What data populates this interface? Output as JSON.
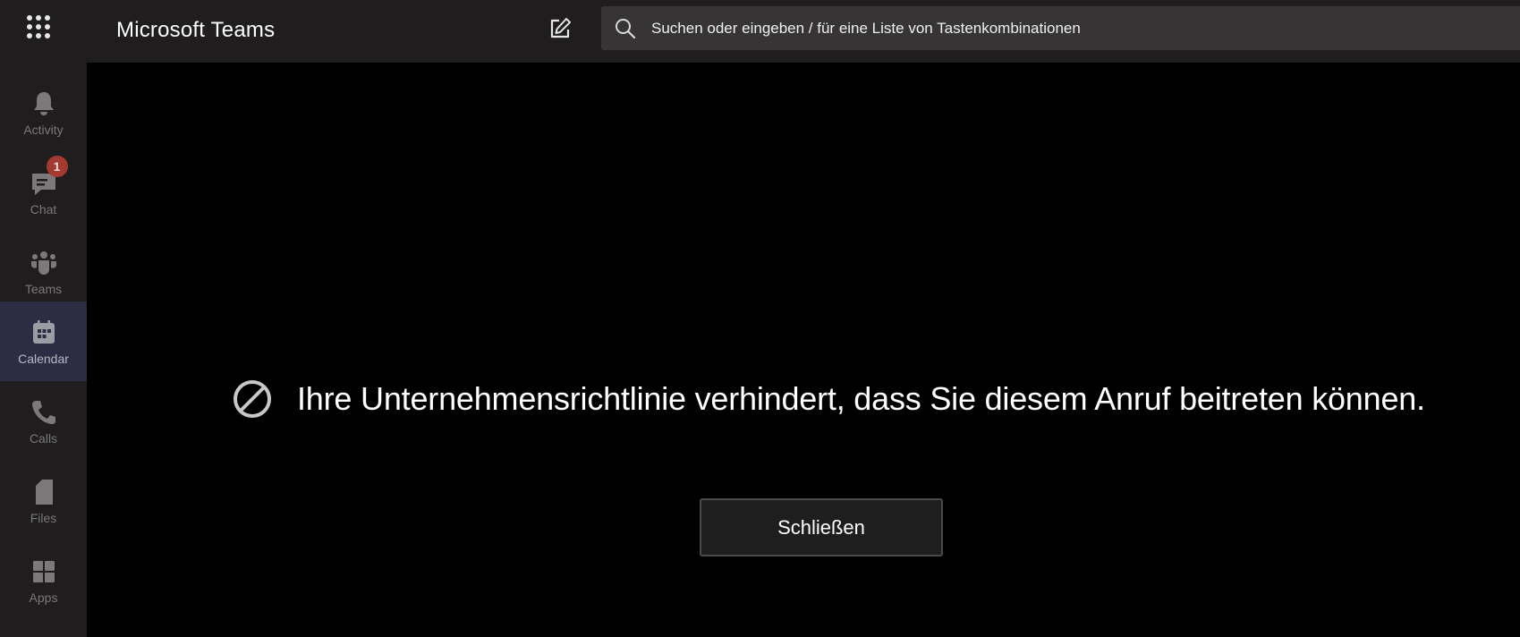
{
  "header": {
    "app_title": "Microsoft Teams",
    "search_placeholder": "Suchen oder eingeben / für eine Liste von Tastenkombinationen",
    "icons": {
      "app_launcher": "waffle-grid-icon",
      "compose": "compose-icon",
      "search": "search-icon"
    }
  },
  "sidebar": {
    "items": [
      {
        "label": "Activity",
        "icon": "bell-icon",
        "active": false
      },
      {
        "label": "Chat",
        "icon": "chat-icon",
        "active": false,
        "badge": "1"
      },
      {
        "label": "Teams",
        "icon": "teams-icon",
        "active": false
      },
      {
        "label": "Calendar",
        "icon": "calendar-icon",
        "active": true
      },
      {
        "label": "Calls",
        "icon": "phone-icon",
        "active": false
      },
      {
        "label": "Files",
        "icon": "file-icon",
        "active": false
      },
      {
        "label": "Apps",
        "icon": "apps-icon",
        "active": false
      }
    ],
    "active_color": "#2c2d45",
    "badge_color": "#a33a30"
  },
  "main": {
    "message": "Ihre Unternehmensrichtlinie verhindert, dass Sie diesem Anruf beitreten können.",
    "message_icon": "block-icon",
    "close_button_label": "Schließen"
  }
}
